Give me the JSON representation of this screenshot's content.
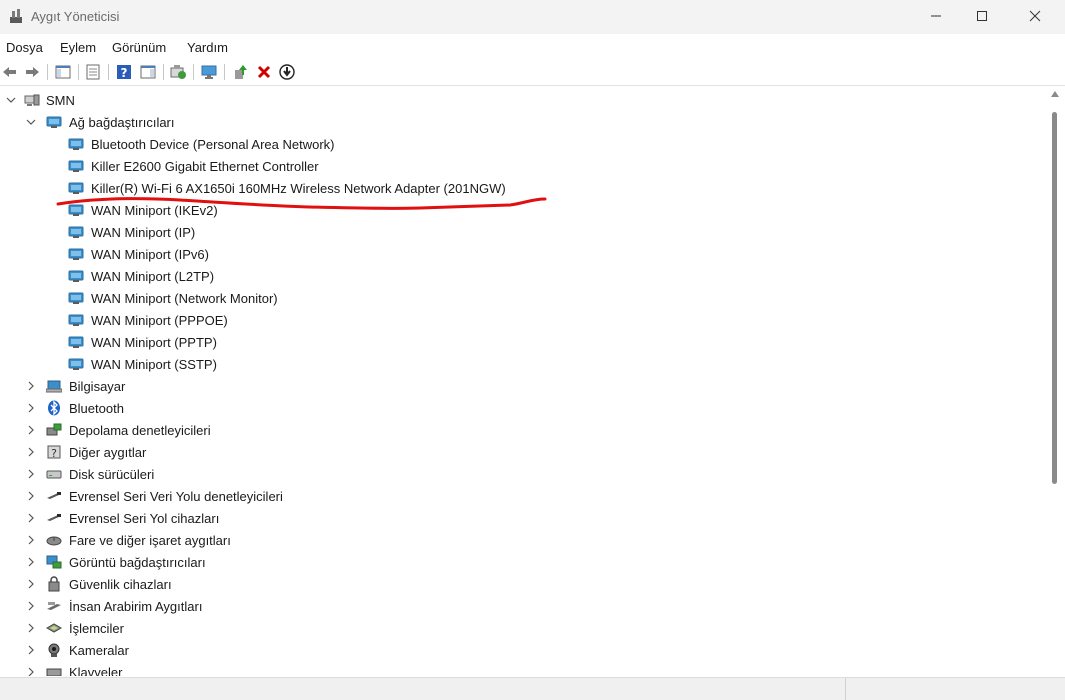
{
  "window": {
    "title": "Aygıt Yöneticisi"
  },
  "menu": [
    "Dosya",
    "Eylem",
    "Görünüm",
    "Yardım"
  ],
  "toolbar": [
    {
      "name": "back-arrow-icon"
    },
    {
      "name": "forward-arrow-icon"
    },
    {
      "name": "show-hide-console-tree-icon"
    },
    {
      "name": "properties-icon"
    },
    {
      "name": "help-icon"
    },
    {
      "name": "action-pane-icon"
    },
    {
      "name": "scan-hardware-changes-icon"
    },
    {
      "name": "monitor-icon"
    },
    {
      "name": "update-driver-icon"
    },
    {
      "name": "uninstall-device-icon",
      "color": "#d10000"
    },
    {
      "name": "disable-device-icon"
    }
  ],
  "tree": {
    "root": "SMN",
    "expanded_category": "Ağ bağdaştırıcıları",
    "network_adapters": [
      "Bluetooth Device (Personal Area Network)",
      "Killer E2600 Gigabit Ethernet Controller",
      "Killer(R) Wi-Fi 6 AX1650i 160MHz Wireless Network Adapter (201NGW)",
      "WAN Miniport (IKEv2)",
      "WAN Miniport (IP)",
      "WAN Miniport (IPv6)",
      "WAN Miniport (L2TP)",
      "WAN Miniport (Network Monitor)",
      "WAN Miniport (PPPOE)",
      "WAN Miniport (PPTP)",
      "WAN Miniport (SSTP)"
    ],
    "categories": [
      {
        "label": "Bilgisayar",
        "icon": "computer-icon"
      },
      {
        "label": "Bluetooth",
        "icon": "bluetooth-icon"
      },
      {
        "label": "Depolama denetleyicileri",
        "icon": "storage-controller-icon"
      },
      {
        "label": "Diğer aygıtlar",
        "icon": "other-devices-icon"
      },
      {
        "label": "Disk sürücüleri",
        "icon": "disk-drive-icon"
      },
      {
        "label": "Evrensel Seri Veri Yolu denetleyicileri",
        "icon": "usb-controller-icon"
      },
      {
        "label": "Evrensel Seri Yol cihazları",
        "icon": "usb-device-icon"
      },
      {
        "label": "Fare ve diğer işaret aygıtları",
        "icon": "mouse-icon"
      },
      {
        "label": "Görüntü bağdaştırıcıları",
        "icon": "display-adapter-icon"
      },
      {
        "label": "Güvenlik cihazları",
        "icon": "security-device-icon"
      },
      {
        "label": "İnsan Arabirim Aygıtları",
        "icon": "hid-icon"
      },
      {
        "label": "İşlemciler",
        "icon": "processor-icon"
      },
      {
        "label": "Kameralar",
        "icon": "camera-icon"
      },
      {
        "label": "Klavyeler",
        "icon": "keyboard-icon"
      }
    ]
  },
  "colors": {
    "highlight_underline": "#e01010",
    "adapter_icon": "#3a8fcb"
  }
}
